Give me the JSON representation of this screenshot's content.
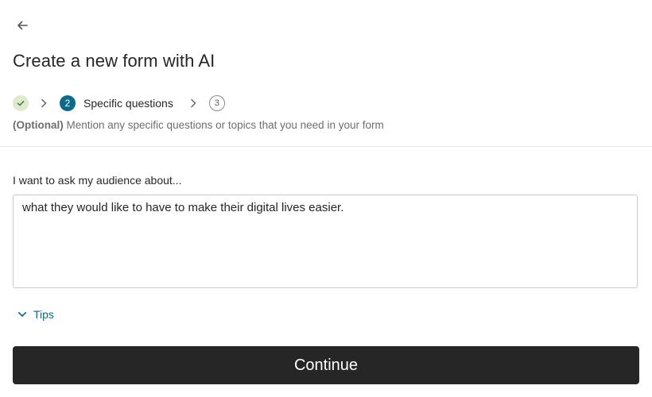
{
  "header": {
    "back_icon": "arrow-left-icon",
    "title": "Create a new form with AI"
  },
  "stepper": {
    "step1": {
      "status": "completed",
      "icon": "checkmark-icon"
    },
    "step2": {
      "number": "2",
      "label": "Specific questions",
      "status": "current"
    },
    "step3": {
      "number": "3",
      "status": "upcoming"
    },
    "separator_icon": "chevron-right-icon"
  },
  "subtitle": {
    "optional": "(Optional)",
    "text": " Mention any specific questions or topics that you need in your form"
  },
  "form": {
    "label": "I want to ask my audience about...",
    "value": "what they would like to have to make their digital lives easier."
  },
  "tips": {
    "icon": "chevron-down-icon",
    "label": "Tips"
  },
  "actions": {
    "continue_label": "Continue"
  },
  "colors": {
    "accent": "#0b6b8b",
    "completed_step_bg": "#dfe9cc",
    "primary_button_bg": "#262627"
  }
}
